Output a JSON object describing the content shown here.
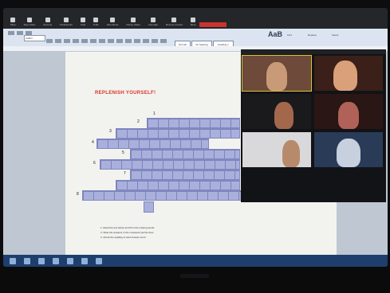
{
  "zoom_toolbar": {
    "items": [
      "Mute",
      "Stop Video",
      "Security",
      "Participants",
      "Chat",
      "Polls",
      "New Share",
      "Pause Share",
      "Annotate",
      "Remote Control",
      "More"
    ],
    "share_badge": ""
  },
  "ribbon": {
    "font_name": "Calibri",
    "styles": [
      "Normal",
      "No Spacing",
      "Heading 1"
    ],
    "change_styles": "AaB",
    "find": "Find",
    "replace": "Replace",
    "select": "Select"
  },
  "document": {
    "title": "REPLENISH YOURSELF!",
    "numbers": [
      "1",
      "2",
      "3",
      "4",
      "5",
      "6",
      "7",
      "8"
    ],
    "clues": [
      "1. Read the text below and fill in the missing words",
      "2. Write the answers in the crossword puzzle lines",
      "3. Check the spelling of each answer word"
    ]
  },
  "gallery": {
    "participants": [
      {
        "name": "",
        "bg": "#6d4a39",
        "skin": "#c99a78"
      },
      {
        "name": "",
        "bg": "#3a2018",
        "skin": "#d9a07a"
      },
      {
        "name": "",
        "bg": "#1a1a1c",
        "skin": "#a3684c"
      },
      {
        "name": "",
        "bg": "#2a1614",
        "skin": "#b06258"
      },
      {
        "name": "",
        "bg": "#d9d9db",
        "skin": "#b78a6c"
      },
      {
        "name": "",
        "bg": "#2a3b57",
        "skin": "#c6d0de"
      }
    ]
  },
  "taskbar": {
    "time": "",
    "date": ""
  }
}
